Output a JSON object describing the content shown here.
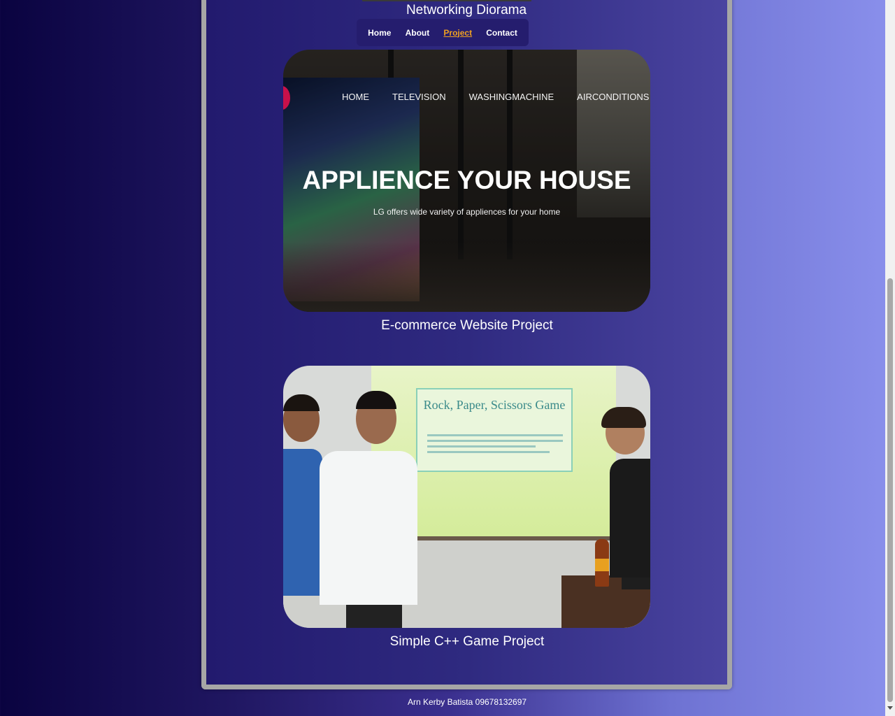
{
  "header": {
    "site_title": "Networking Diorama"
  },
  "nav": {
    "items": [
      {
        "label": "Home",
        "active": false
      },
      {
        "label": "About",
        "active": false
      },
      {
        "label": "Project",
        "active": true
      },
      {
        "label": "Contact",
        "active": false
      }
    ],
    "active_color": "#f0a020"
  },
  "projects": [
    {
      "caption": "E-commerce Website Project",
      "screenshot": {
        "menu": [
          "HOME",
          "TELEVISION",
          "WASHINGMACHINE",
          "AIRCONDITIONS"
        ],
        "headline": "APPLIENCE YOUR HOUSE",
        "subline": "LG offers wide variety of appliences for your home"
      }
    },
    {
      "caption": "Simple C++ Game Project",
      "photo": {
        "slide_title": "Rock, Paper, Scissors Game"
      }
    }
  ],
  "footer": {
    "text": "Arn Kerby Batista 09678132697"
  }
}
